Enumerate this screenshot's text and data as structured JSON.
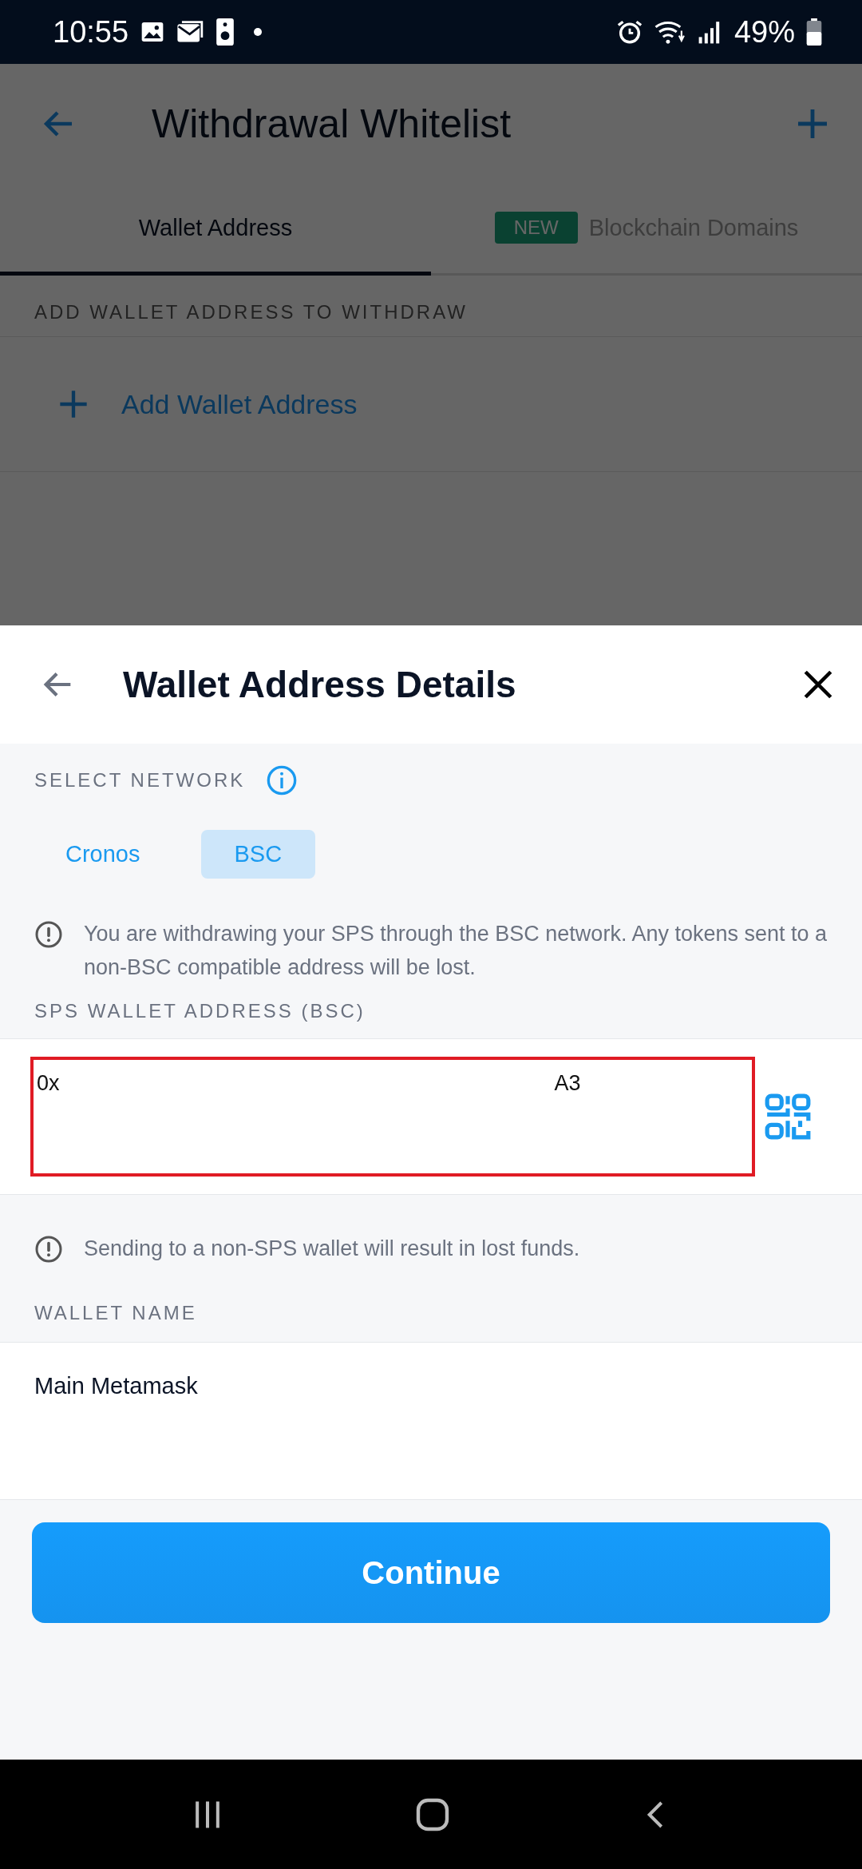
{
  "status_bar": {
    "time": "10:55",
    "battery": "49%"
  },
  "app_bar": {
    "title": "Withdrawal Whitelist"
  },
  "tabs": [
    {
      "label": "Wallet Address",
      "selected": true
    },
    {
      "label": "Blockchain Domains",
      "selected": false,
      "badge": "NEW"
    }
  ],
  "section": {
    "label": "ADD WALLET ADDRESS TO WITHDRAW",
    "action": "Add Wallet Address"
  },
  "sheet": {
    "title": "Wallet Address Details",
    "network_label": "SELECT NETWORK",
    "networks": [
      {
        "label": "Cronos",
        "selected": false
      },
      {
        "label": "BSC",
        "selected": true
      }
    ],
    "network_notice": "You are withdrawing your SPS through the BSC network. Any tokens sent to a non-BSC compatible address will be lost.",
    "address_label": "SPS WALLET ADDRESS (BSC)",
    "address": {
      "start": "0x",
      "end": "A3"
    },
    "address_notice": "Sending to a non-SPS wallet will result in lost funds.",
    "name_label": "WALLET NAME",
    "name_value": "Main Metamask",
    "button": "Continue"
  }
}
